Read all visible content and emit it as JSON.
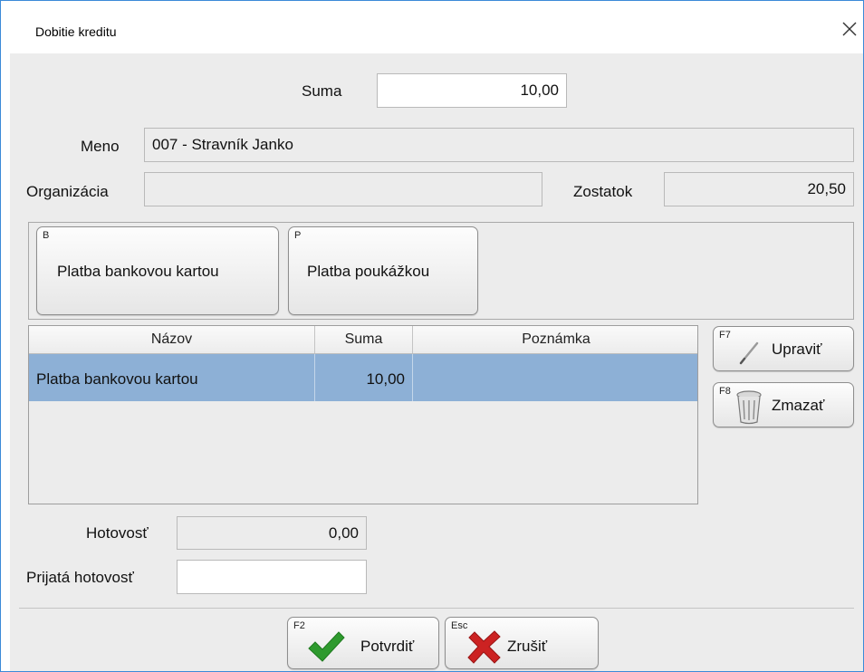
{
  "window": {
    "title": "Dobitie kreditu"
  },
  "form": {
    "suma_label": "Suma",
    "suma_value": "10,00",
    "meno_label": "Meno",
    "meno_value": "007 - Stravník Janko",
    "organizacia_label": "Organizácia",
    "organizacia_value": "",
    "zostatok_label": "Zostatok",
    "zostatok_value": "20,50"
  },
  "payment_buttons": [
    {
      "hotkey": "B",
      "label": "Platba bankovou kartou"
    },
    {
      "hotkey": "P",
      "label": "Platba poukážkou"
    }
  ],
  "table": {
    "columns": [
      "Názov",
      "Suma",
      "Poznámka"
    ],
    "rows": [
      {
        "nazov": "Platba bankovou kartou",
        "suma": "10,00",
        "poznamka": "",
        "selected": true
      }
    ]
  },
  "side_buttons": {
    "edit": {
      "hotkey": "F7",
      "label": "Upraviť",
      "icon": "pencil-icon"
    },
    "delete": {
      "hotkey": "F8",
      "label": "Zmazať",
      "icon": "trash-icon"
    }
  },
  "cash": {
    "hotovost_label": "Hotovosť",
    "hotovost_value": "0,00",
    "prijata_label": "Prijatá hotovosť",
    "prijata_value": ""
  },
  "footer": {
    "confirm": {
      "hotkey": "F2",
      "label": "Potvrdiť",
      "icon": "checkmark-icon"
    },
    "cancel": {
      "hotkey": "Esc",
      "label": "Zrušiť",
      "icon": "cross-icon"
    }
  },
  "colors": {
    "selection": "#8db0d6",
    "check": "#2e9a2e",
    "cross": "#cc2222",
    "window_border": "#3c8ad8"
  }
}
